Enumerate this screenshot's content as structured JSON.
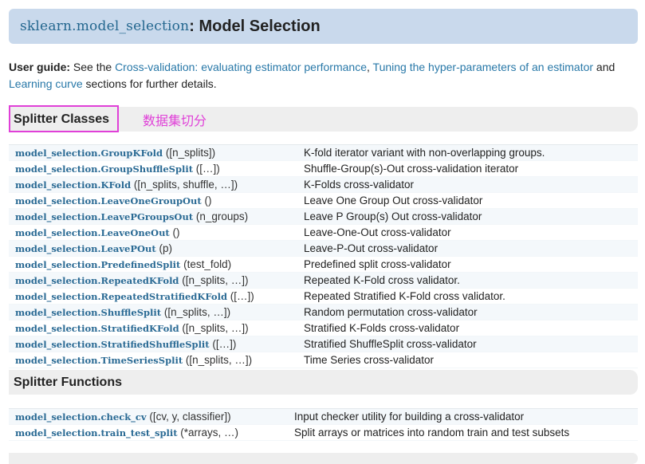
{
  "header": {
    "module": "sklearn.model_selection",
    "title": ": Model Selection"
  },
  "guide": {
    "label": "User guide:",
    "text_see": " See the ",
    "link1": "Cross-validation: evaluating estimator performance",
    "sep": ", ",
    "link2": "Tuning the hyper-parameters of an estimator",
    "and": " and ",
    "link3": "Learning curve",
    "tail": " sections for further details."
  },
  "splitter_classes": {
    "heading": "Splitter Classes",
    "annotation": "数据集切分",
    "rows": [
      {
        "name": "model_selection.GroupKFold",
        "args": " ([n_splits])",
        "desc": "K-fold iterator variant with non-overlapping groups."
      },
      {
        "name": "model_selection.GroupShuffleSplit",
        "args": " ([…])",
        "desc": "Shuffle-Group(s)-Out cross-validation iterator"
      },
      {
        "name": "model_selection.KFold",
        "args": " ([n_splits, shuffle, …])",
        "desc": "K-Folds cross-validator"
      },
      {
        "name": "model_selection.LeaveOneGroupOut",
        "args": " ()",
        "desc": "Leave One Group Out cross-validator"
      },
      {
        "name": "model_selection.LeavePGroupsOut",
        "args": " (n_groups)",
        "desc": "Leave P Group(s) Out cross-validator"
      },
      {
        "name": "model_selection.LeaveOneOut",
        "args": " ()",
        "desc": "Leave-One-Out cross-validator"
      },
      {
        "name": "model_selection.LeavePOut",
        "args": " (p)",
        "desc": "Leave-P-Out cross-validator"
      },
      {
        "name": "model_selection.PredefinedSplit",
        "args": " (test_fold)",
        "desc": "Predefined split cross-validator"
      },
      {
        "name": "model_selection.RepeatedKFold",
        "args": " ([n_splits, …])",
        "desc": "Repeated K-Fold cross validator."
      },
      {
        "name": "model_selection.RepeatedStratifiedKFold",
        "args": " ([…])",
        "desc": "Repeated Stratified K-Fold cross validator."
      },
      {
        "name": "model_selection.ShuffleSplit",
        "args": " ([n_splits, …])",
        "desc": "Random permutation cross-validator"
      },
      {
        "name": "model_selection.StratifiedKFold",
        "args": " ([n_splits, …])",
        "desc": "Stratified K-Folds cross-validator"
      },
      {
        "name": "model_selection.StratifiedShuffleSplit",
        "args": " ([…])",
        "desc": "Stratified ShuffleSplit cross-validator"
      },
      {
        "name": "model_selection.TimeSeriesSplit",
        "args": " ([n_splits, …])",
        "desc": "Time Series cross-validator"
      }
    ]
  },
  "splitter_functions": {
    "heading": "Splitter Functions",
    "rows": [
      {
        "name": "model_selection.check_cv",
        "args": " ([cv, y, classifier])",
        "desc": "Input checker utility for building a cross-validator"
      },
      {
        "name": "model_selection.train_test_split",
        "args": " (*arrays, …)",
        "desc": "Split arrays or matrices into random train and test subsets"
      }
    ]
  },
  "colors": {
    "title_bg": "#c9d9ec",
    "link": "#2878a8",
    "module_name": "#2a6a94",
    "annotation": "#e040d8",
    "section_bg": "#eeeeee"
  }
}
